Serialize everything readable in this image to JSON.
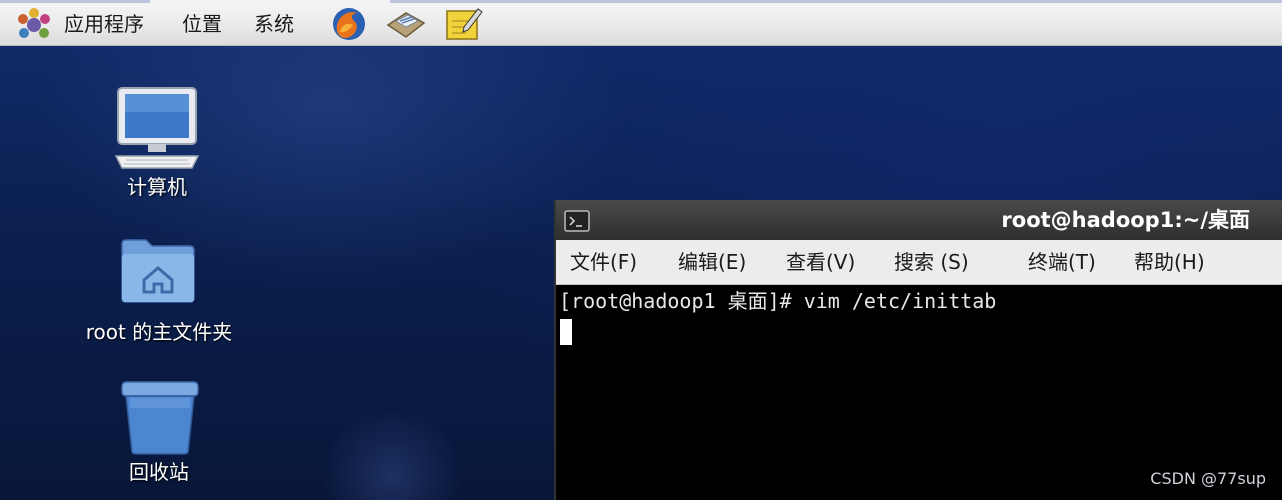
{
  "top_panel": {
    "menus": [
      "应用程序",
      "位置",
      "系统"
    ],
    "launchers": [
      "firefox-icon",
      "mail-icon",
      "notes-icon"
    ]
  },
  "desktop": {
    "icons": [
      {
        "label": "计算机",
        "icon": "computer-icon"
      },
      {
        "label": "root 的主文件夹",
        "icon": "home-folder-icon"
      },
      {
        "label": "回收站",
        "icon": "trash-icon"
      }
    ]
  },
  "terminal": {
    "title": "root@hadoop1:~/桌面",
    "menus": [
      "文件(F)",
      "编辑(E)",
      "查看(V)",
      "搜索 (S)",
      "终端(T)",
      "帮助(H)"
    ],
    "line": "[root@hadoop1 桌面]# vim /etc/inittab"
  },
  "watermark": "CSDN @77sup",
  "colors": {
    "panel": "#e9e9e9",
    "desktop": "#0c1d4a",
    "terminal_bg": "#000000",
    "terminal_title": "#3a3a3a"
  }
}
